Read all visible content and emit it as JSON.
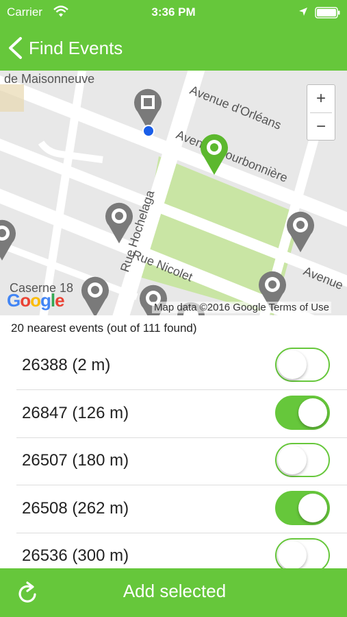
{
  "status": {
    "carrier": "Carrier",
    "time": "3:36 PM"
  },
  "nav": {
    "back_label": "Find Events"
  },
  "map": {
    "streets": [
      "de Maisonneuve",
      "Avenue d'Orléans",
      "Avenue Bourbonnière",
      "Rue Hochelaga",
      "Rue Nicolet",
      "Avenue",
      "Caserne 18",
      "Caserne 18"
    ],
    "zoom_in": "+",
    "zoom_out": "−",
    "copyright": "Map data ©2016 Google   Terms of Use",
    "google_logo": [
      "G",
      "o",
      "o",
      "g",
      "l",
      "e"
    ]
  },
  "list": {
    "header": "20 nearest events (out of 111 found)",
    "items": [
      {
        "label": "26388 (2 m)",
        "selected": false
      },
      {
        "label": "26847 (126 m)",
        "selected": true
      },
      {
        "label": "26507 (180 m)",
        "selected": false
      },
      {
        "label": "26508 (262 m)",
        "selected": true
      },
      {
        "label": "26536 (300 m)",
        "selected": false
      }
    ]
  },
  "bottom": {
    "add_label": "Add selected"
  },
  "colors": {
    "accent": "#66c73b",
    "pin_gray": "#7a7a7a",
    "pin_green": "#5cb82e",
    "park": "#c9e5a4",
    "dot": "#1a5ee8"
  }
}
